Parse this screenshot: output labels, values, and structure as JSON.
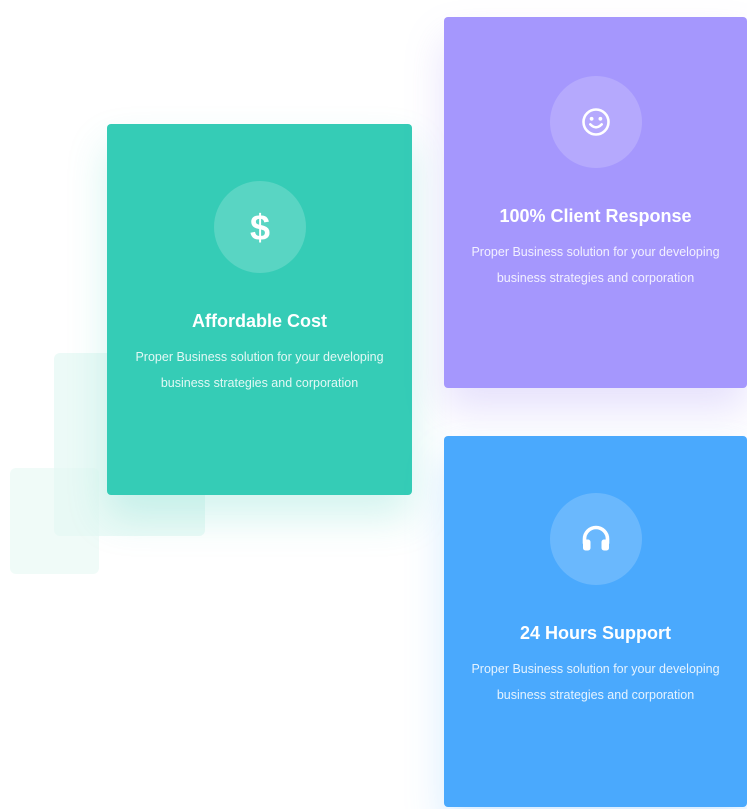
{
  "cards": [
    {
      "icon": "dollar-icon",
      "title": "Affordable Cost",
      "description": "Proper Business solution for your developing business strategies and corporation",
      "color": "#35ccb6"
    },
    {
      "icon": "smiley-icon",
      "title": "100% Client Response",
      "description": "Proper Business solution for your developing business strategies and corporation",
      "color": "#a597fd"
    },
    {
      "icon": "headphones-icon",
      "title": "24 Hours Support",
      "description": "Proper Business solution for your developing business strategies and corporation",
      "color": "#4aa9fd"
    }
  ]
}
